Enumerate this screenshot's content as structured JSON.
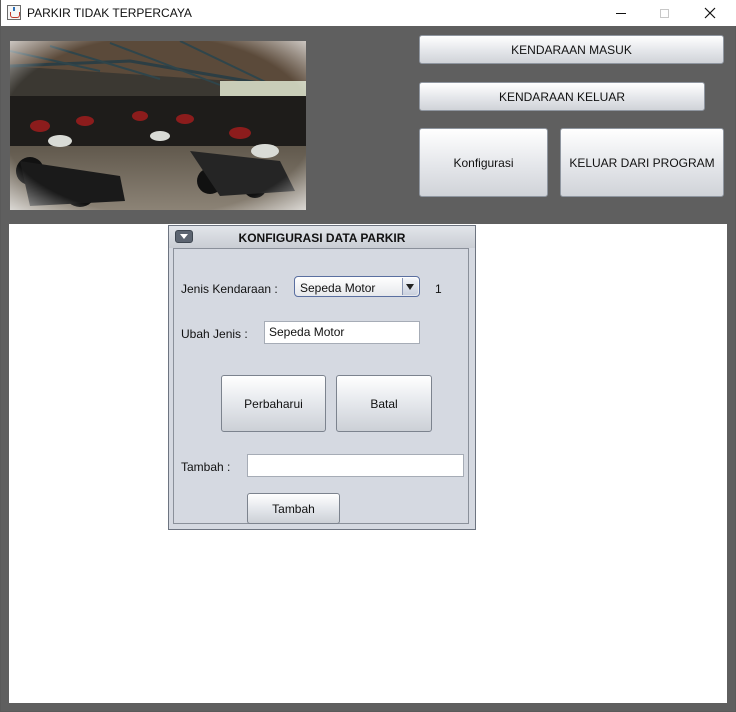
{
  "window": {
    "title": "PARKIR TIDAK TERPERCAYA"
  },
  "main": {
    "buttons": {
      "kendaraan_masuk": "KENDARAAN MASUK",
      "kendaraan_keluar": "KENDARAAN KELUAR",
      "konfigurasi": "Konfigurasi",
      "keluar_program": "KELUAR DARI PROGRAM"
    }
  },
  "dialog": {
    "title": "KONFIGURASI DATA PARKIR",
    "jenis_label": "Jenis Kendaraan :",
    "jenis_selected": "Sepeda Motor",
    "jenis_id": "1",
    "ubah_label": "Ubah Jenis :",
    "ubah_value": "Sepeda Motor",
    "perbaharui": "Perbaharui",
    "batal": "Batal",
    "tambah_label": "Tambah :",
    "tambah_value": "",
    "tambah_button": "Tambah"
  }
}
